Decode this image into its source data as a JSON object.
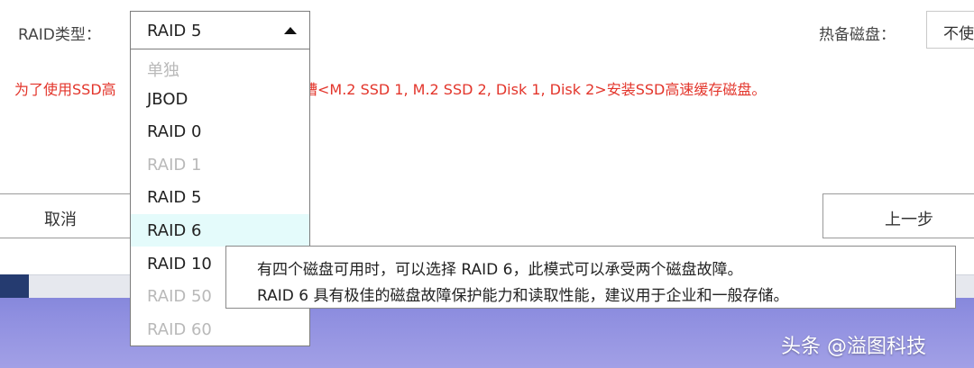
{
  "raid_type": {
    "label": "RAID类型：",
    "selected_value": "RAID 5",
    "options": [
      {
        "label": "单独",
        "disabled": true
      },
      {
        "label": "JBOD",
        "disabled": false
      },
      {
        "label": "RAID 0",
        "disabled": false
      },
      {
        "label": "RAID 1",
        "disabled": true
      },
      {
        "label": "RAID 5",
        "disabled": false
      },
      {
        "label": "RAID 6",
        "disabled": false,
        "hovered": true
      },
      {
        "label": "RAID 10",
        "disabled": false
      },
      {
        "label": "RAID 50",
        "disabled": true
      },
      {
        "label": "RAID 60",
        "disabled": true
      }
    ]
  },
  "hot_spare": {
    "label": "热备磁盘：",
    "value": "不使"
  },
  "warning": {
    "text_left": "为了使用SSD高",
    "text_right": "插槽<M.2 SSD 1, M.2 SSD 2, Disk 1, Disk 2>安装SSD高速缓存磁盘。"
  },
  "buttons": {
    "cancel": "取消",
    "prev": "上一步"
  },
  "tooltip": {
    "line1": "有四个磁盘可用时，可以选择 RAID 6，此模式可以承受两个磁盘故障。",
    "line2": "RAID 6 具有极佳的磁盘故障保护能力和读取性能，建议用于企业和一般存储。"
  },
  "watermark": "头条 @溢图科技",
  "colors": {
    "warning": "#e3352b",
    "hover_bg": "#e4fbfb",
    "disabled_text": "#b9b9b9",
    "background_band": "#8f8fe0"
  }
}
